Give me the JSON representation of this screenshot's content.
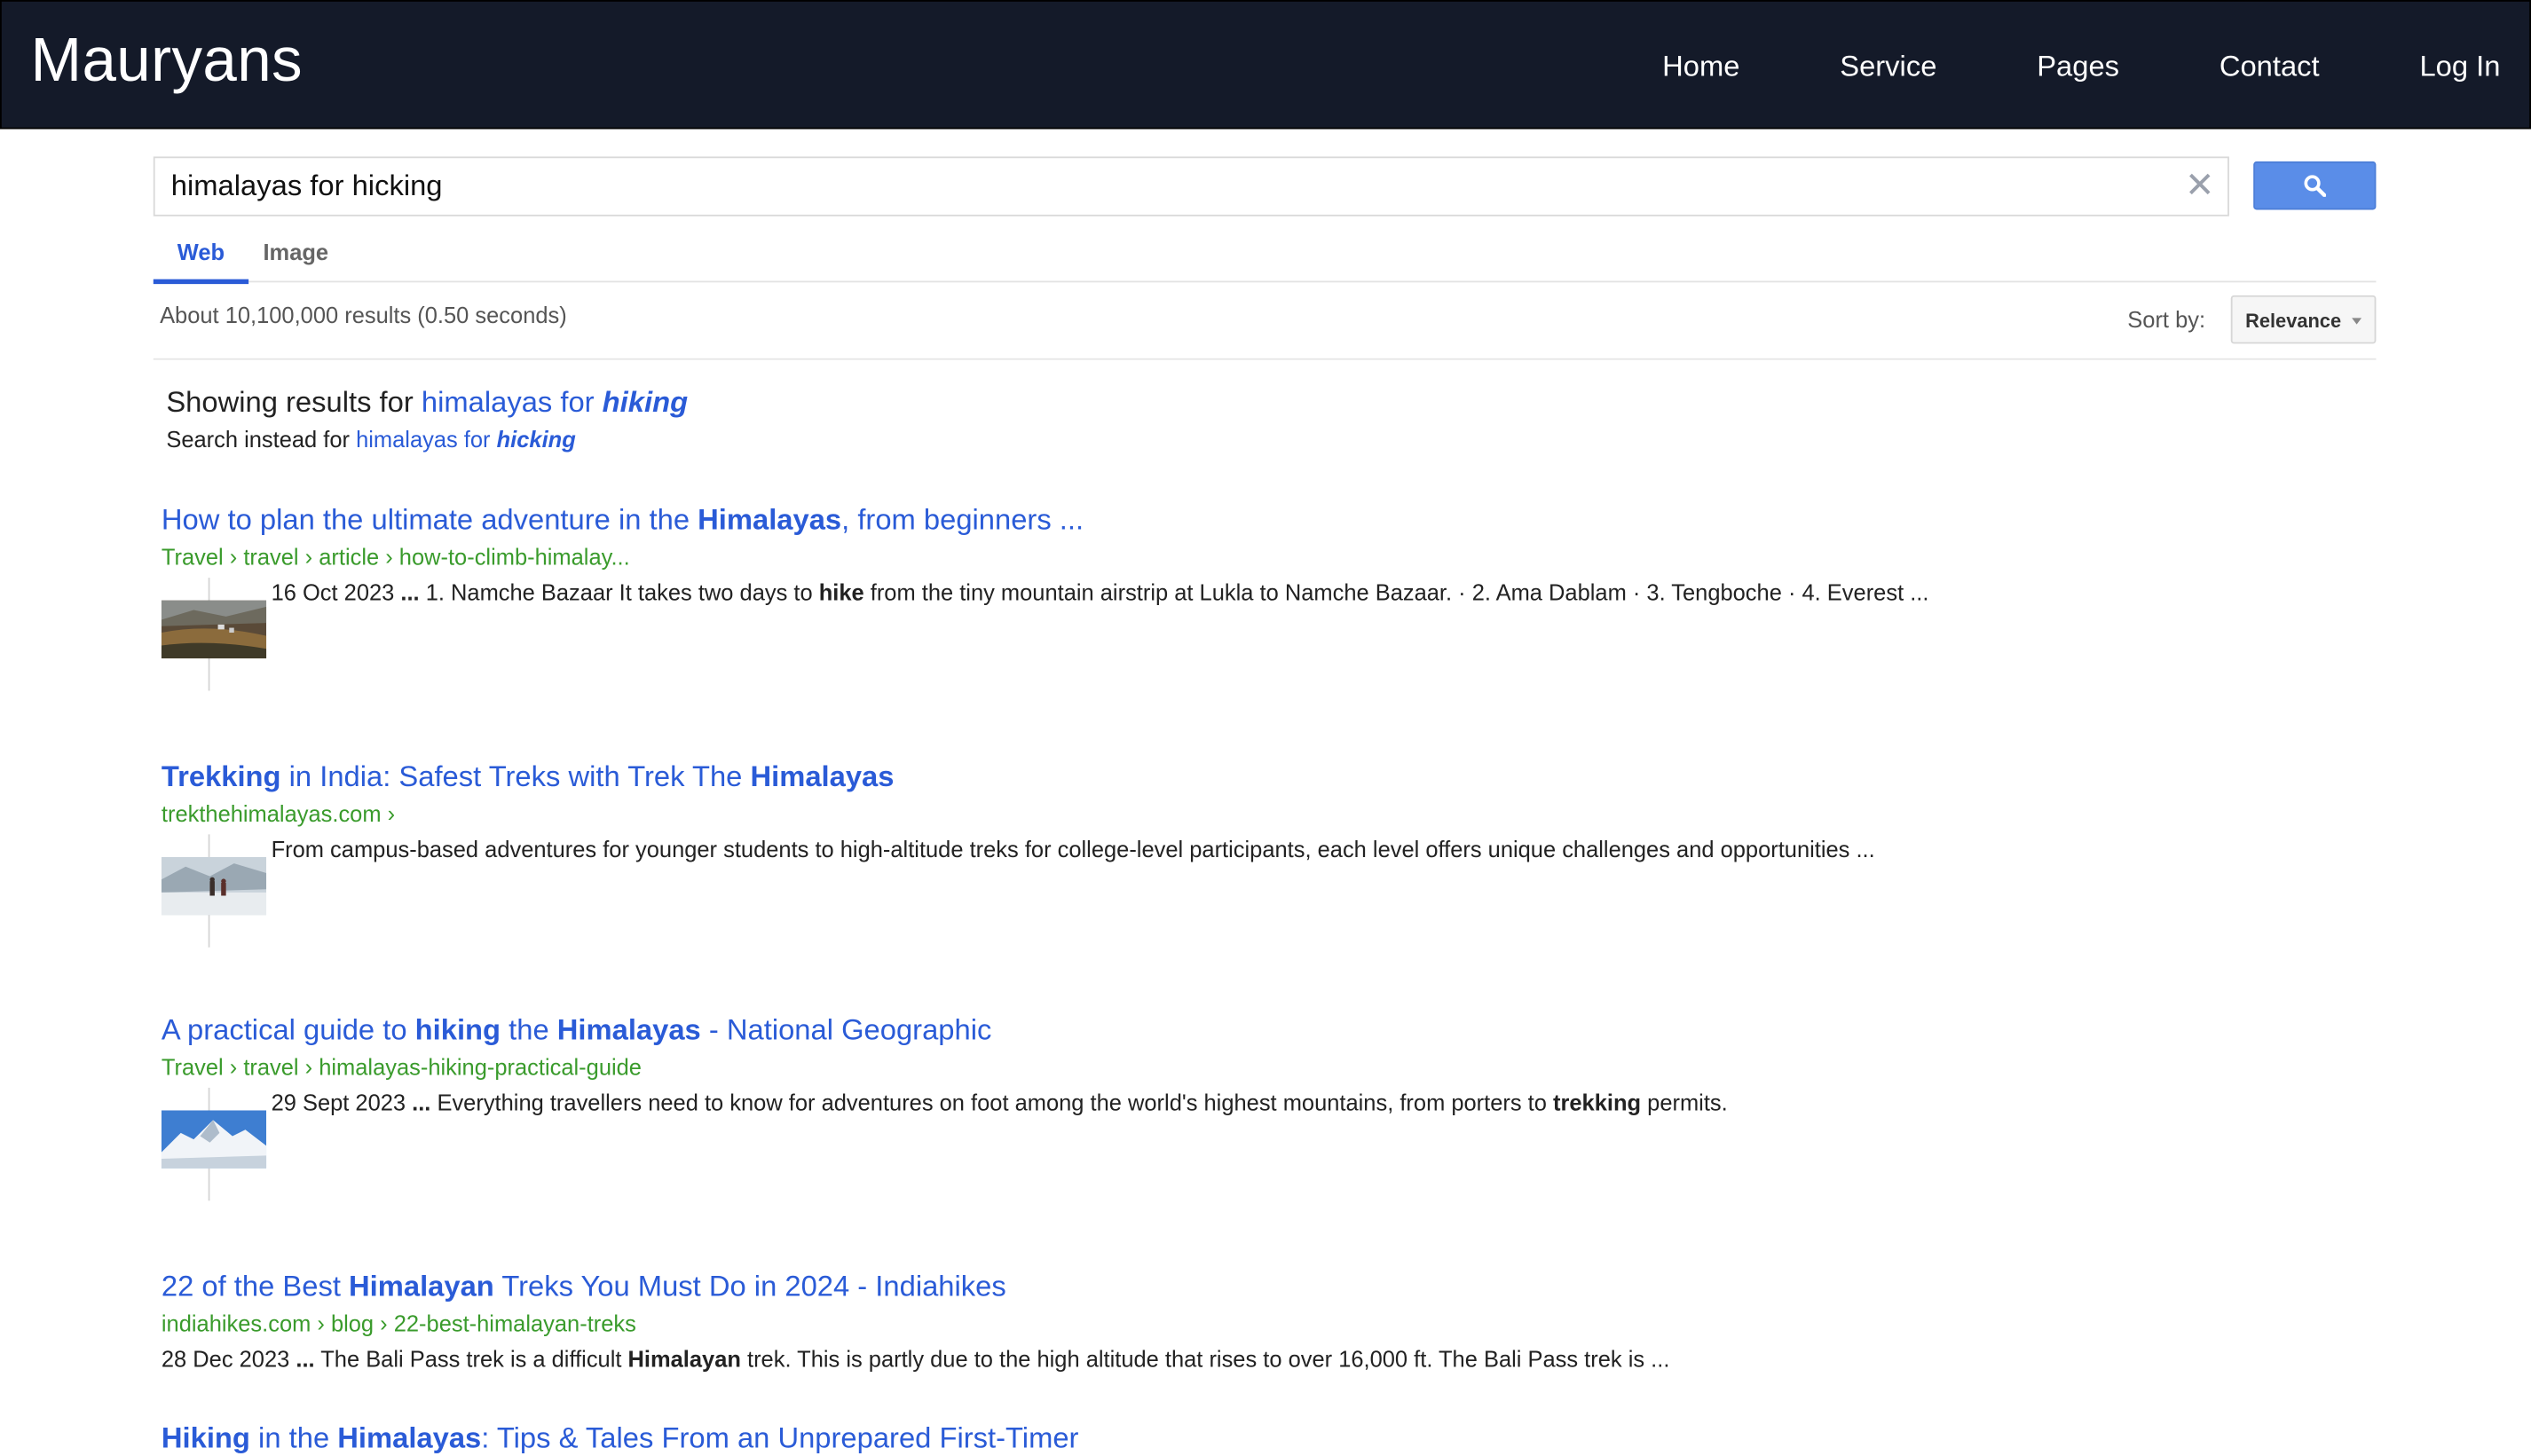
{
  "brand": "Mauryans",
  "nav": [
    "Home",
    "Service",
    "Pages",
    "Contact",
    "Log In"
  ],
  "search": {
    "value": "himalayas for hicking",
    "clear_icon": "close-icon",
    "button_icon": "search-icon"
  },
  "tabs": [
    "Web",
    "Image"
  ],
  "results_meta": "About 10,100,000 results (0.50 seconds)",
  "sort": {
    "label": "Sort by:",
    "value": "Relevance"
  },
  "correction": {
    "showing_prefix": "Showing results for ",
    "showing_plain": "himalayas for ",
    "showing_bold": "hiking",
    "instead_prefix": "Search instead for ",
    "instead_plain": "himalayas for ",
    "instead_bold": "hicking"
  },
  "results": [
    {
      "title": [
        [
          "How to plan the ultimate adventure in the ",
          false
        ],
        [
          "Himalayas",
          true
        ],
        [
          ", from beginners ...",
          false
        ]
      ],
      "url": "Travel › travel › article › how-to-climb-himalay...",
      "snippet": [
        [
          "16 Oct 2023 ",
          false
        ],
        [
          "...",
          true
        ],
        [
          " 1. Namche Bazaar It takes two days to ",
          false
        ],
        [
          "hike",
          true
        ],
        [
          " from the tiny mountain airstrip at Lukla to Namche Bazaar. · 2. Ama Dablam · 3. Tengboche · 4. Everest ...",
          false
        ]
      ],
      "thumb": "village-landscape"
    },
    {
      "title": [
        [
          "Trekking",
          true
        ],
        [
          " in India: Safest Treks with Trek The ",
          false
        ],
        [
          "Himalayas",
          true
        ]
      ],
      "url": "trekthehimalayas.com ›",
      "snippet": [
        [
          "From campus-based adventures for younger students to high-altitude treks for college-level participants, each level offers unique challenges and opportunities ...",
          false
        ]
      ],
      "thumb": "trekkers-snow"
    },
    {
      "title": [
        [
          "A practical guide to ",
          false
        ],
        [
          "hiking",
          true
        ],
        [
          " the ",
          false
        ],
        [
          "Himalayas",
          true
        ],
        [
          " - National Geographic",
          false
        ]
      ],
      "url": "Travel › travel › himalayas-hiking-practical-guide",
      "snippet": [
        [
          "29 Sept 2023 ",
          false
        ],
        [
          "...",
          true
        ],
        [
          " Everything travellers need to know for adventures on foot among the world's highest mountains, from porters to ",
          false
        ],
        [
          "trekking",
          true
        ],
        [
          " permits.",
          false
        ]
      ],
      "thumb": "snowy-peaks"
    },
    {
      "title": [
        [
          "22 of the Best ",
          false
        ],
        [
          "Himalayan",
          true
        ],
        [
          " Treks You Must Do in 2024 - Indiahikes",
          false
        ]
      ],
      "url": "indiahikes.com › blog › 22-best-himalayan-treks",
      "snippet": [
        [
          "28 Dec 2023 ",
          false
        ],
        [
          "...",
          true
        ],
        [
          " The Bali Pass trek is a difficult ",
          false
        ],
        [
          "Himalayan",
          true
        ],
        [
          " trek. This is partly due to the high altitude that rises to over 16,000 ft. The Bali Pass trek is ...",
          false
        ]
      ],
      "thumb": null
    },
    {
      "title": [
        [
          "Hiking",
          true
        ],
        [
          " in the ",
          false
        ],
        [
          "Himalayas",
          true
        ],
        [
          ": Tips & Tales From an Unprepared First-Timer",
          false
        ]
      ],
      "url": "",
      "snippet": [],
      "thumb": null
    }
  ]
}
